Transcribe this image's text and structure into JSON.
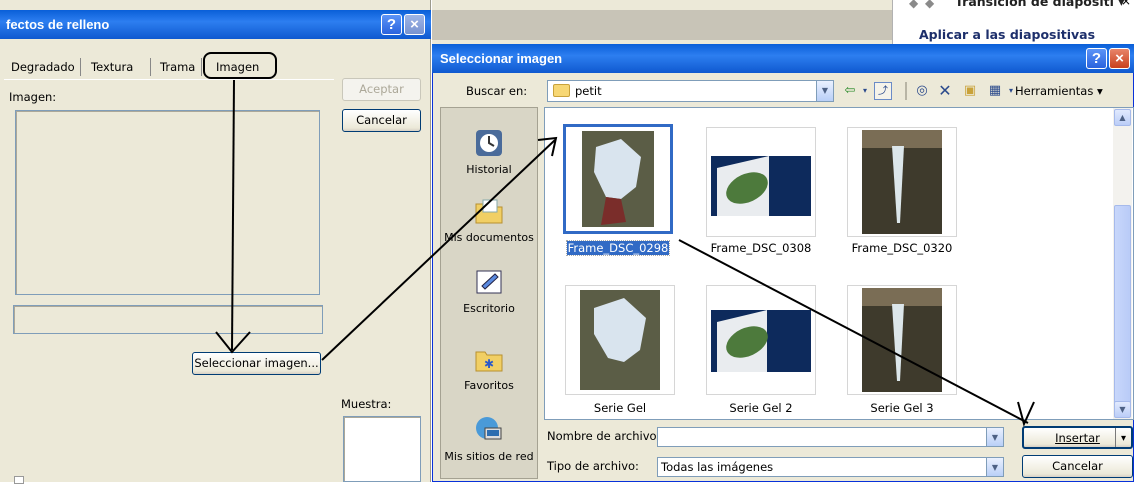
{
  "left_dialog": {
    "title": "fectos de relleno",
    "help_button": "?",
    "close_button": "×",
    "tabs": [
      {
        "label": "Degradado"
      },
      {
        "label": "Textura"
      },
      {
        "label": "Trama"
      },
      {
        "label": "Imagen",
        "selected": true
      }
    ],
    "image_label": "Imagen:",
    "accept_button": "Aceptar",
    "cancel_button": "Cancelar",
    "select_image_button": "Seleccionar imagen...",
    "preview_label": "Muestra:"
  },
  "task_pane": {
    "top_text": "Transición de diapositi ▾",
    "apply_text": "Aplicar a las diapositivas"
  },
  "select_dialog": {
    "title": "Seleccionar imagen",
    "help_button": "?",
    "close_button": "×",
    "look_in_label": "Buscar en:",
    "look_in_value": "petit",
    "tools_label": "Herramientas",
    "places": [
      {
        "label": "Historial",
        "icon": "history-icon"
      },
      {
        "label": "Mis documentos",
        "icon": "my-documents-icon"
      },
      {
        "label": "Escritorio",
        "icon": "desktop-icon"
      },
      {
        "label": "Favoritos",
        "icon": "favorites-icon"
      },
      {
        "label": "Mis sitios de red",
        "icon": "network-places-icon"
      }
    ],
    "files": [
      {
        "name": "Frame_DSC_0298",
        "selected": true
      },
      {
        "name": "Frame_DSC_0308",
        "selected": false
      },
      {
        "name": "Frame_DSC_0320",
        "selected": false
      },
      {
        "name": "Serie Gel",
        "selected": false
      },
      {
        "name": "Serie Gel 2",
        "selected": false
      },
      {
        "name": "Serie Gel 3",
        "selected": false
      }
    ],
    "filename_label": "Nombre de archivo:",
    "filename_value": "",
    "filetype_label": "Tipo de archivo:",
    "filetype_value": "Todas las imágenes",
    "insert_button": "Insertar",
    "cancel_button": "Cancelar"
  },
  "colors": {
    "titlebar_blue": "#0a5fd8",
    "dialog_bg": "#ece9d8",
    "selection_blue": "#316ac5"
  }
}
